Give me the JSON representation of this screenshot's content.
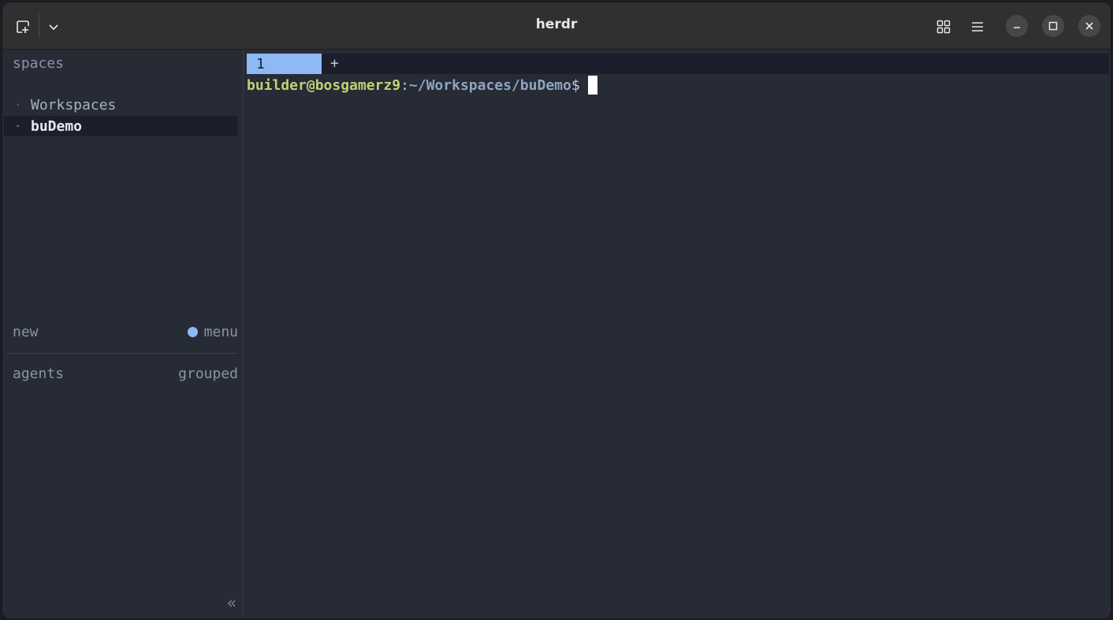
{
  "window": {
    "title": "herdr"
  },
  "header": {
    "icons": [
      "new-tab-icon",
      "chevron-down-icon",
      "grid-icon",
      "hamburger-menu-icon",
      "minimize-icon",
      "maximize-icon",
      "close-icon"
    ]
  },
  "sidebar": {
    "heading": "spaces",
    "spaces": [
      {
        "label": "Workspaces",
        "active": false
      },
      {
        "label": "buDemo",
        "active": true
      }
    ],
    "bullet": "·",
    "new_label": "new",
    "menu_label": "menu",
    "menu_dot_color": "#8fb8f6",
    "agents_label": "agents",
    "grouped_label": "grouped",
    "collapse_glyph": "«"
  },
  "terminal": {
    "tabs": [
      {
        "label": "1",
        "active": true
      }
    ],
    "add_tab_label": "+",
    "prompt": {
      "user_host": "builder@bosgamerz9",
      "colon": ":",
      "path": "~/Workspaces/buDemo",
      "symbol": "$"
    }
  },
  "colors": {
    "background": "#272b35",
    "accent": "#8fb8f6",
    "prompt_user": "#c4cf76",
    "prompt_path": "#8fa4c2"
  }
}
